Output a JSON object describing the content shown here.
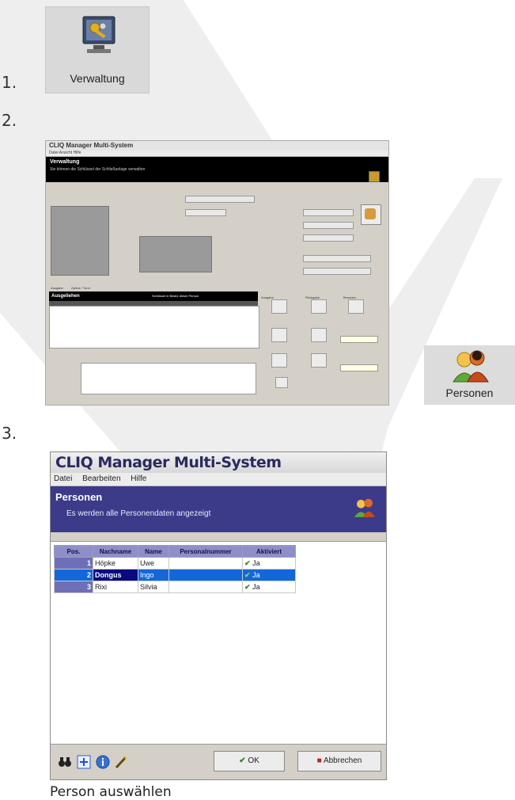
{
  "steps": {
    "s1": "1.",
    "s2": "2.",
    "s3": "3."
  },
  "icon_verwaltung": {
    "label": "Verwaltung",
    "icon": "monitor-keys-icon"
  },
  "icon_personen": {
    "label": "Personen",
    "icon": "people-icon"
  },
  "screen2": {
    "title": "CLIQ Manager Multi-System",
    "menu": "Datei  Ansicht  Hilfe",
    "banner_title": "Verwaltung",
    "banner_subtitle": "Sie können die Schlüssel der Schließanlage verwalten",
    "tabs": [
      "Ausgabe",
      "Zyklus / Turm"
    ],
    "list_title": "Ausgeliehen",
    "list_right": "Schlüssel in Besitz dieser Person",
    "section_labels": [
      "Ausgabe",
      "Rückgabe",
      "Benutzer"
    ]
  },
  "window": {
    "title": "CLIQ Manager Multi-System",
    "menu": [
      "Datei",
      "Bearbeiten",
      "Hilfe"
    ],
    "banner_title": "Personen",
    "banner_subtitle": "Es werden alle Personendaten angezeigt",
    "columns": [
      "Pos.",
      "Nachname",
      "Name",
      "Personalnummer",
      "Aktiviert"
    ],
    "rows": [
      {
        "pos": "1",
        "nachname": "Höpke",
        "name": "Uwe",
        "personalnummer": "",
        "aktiviert": "Ja"
      },
      {
        "pos": "2",
        "nachname": "Dongus",
        "name": "Ingo",
        "personalnummer": "",
        "aktiviert": "Ja"
      },
      {
        "pos": "3",
        "nachname": "Rixi",
        "name": "Silvia",
        "personalnummer": "",
        "aktiviert": "Ja"
      }
    ],
    "selected_row": 2,
    "ok_label": "OK",
    "cancel_label": "Abbrechen"
  },
  "caption": "Person auswählen",
  "colors": {
    "banner": "#3b3b8a",
    "selection": "#1268d8",
    "header": "#8f8fc8"
  }
}
